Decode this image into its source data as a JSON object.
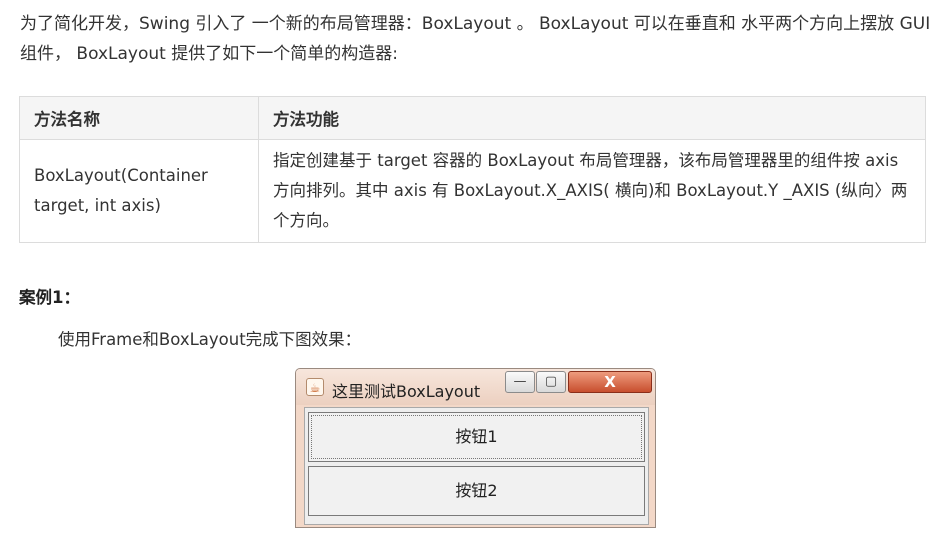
{
  "intro": {
    "text": "为了简化开发，Swing 引入了 一个新的布局管理器：BoxLayout 。 BoxLayout 可以在垂直和 水平两个方向上摆放 GUI 组件， BoxLayout 提供了如下一个简单的构造器:"
  },
  "table": {
    "headers": [
      "方法名称",
      "方法功能"
    ],
    "row": {
      "method": "BoxLayout(Container target, int axis)",
      "description": "指定创建基于 target 容器的 BoxLayout 布局管理器，该布局管理器里的组件按 axis 方向排列。其中 axis 有 BoxLayout.X_AXIS( 横向)和 BoxLayout.Y _AXIS (纵向〉两个方向。"
    }
  },
  "case": {
    "title": "案例1：",
    "description": "使用Frame和BoxLayout完成下图效果："
  },
  "window": {
    "title": "这里测试BoxLayout",
    "minimize_symbol": "—",
    "maximize_symbol": "▢",
    "close_symbol": "X",
    "buttons": [
      "按钮1",
      "按钮2"
    ],
    "icon": "java-cup-icon"
  }
}
